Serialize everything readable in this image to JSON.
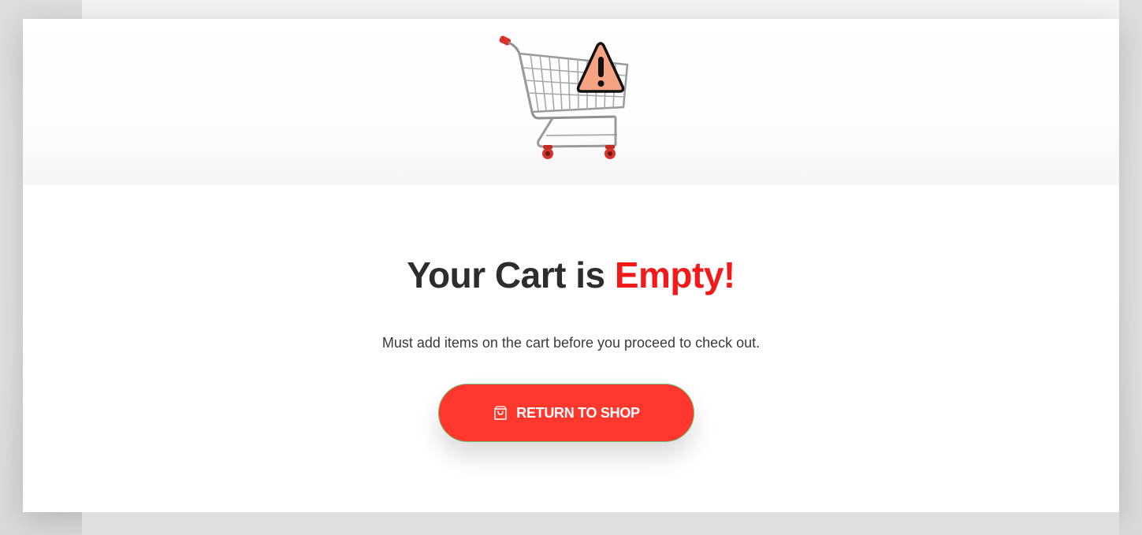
{
  "page": {
    "title_main": "Your Cart is",
    "title_accent": "Empty!",
    "subtitle": "Must add items on the cart before you proceed to check out."
  },
  "actions": {
    "return_label": "RETURN TO SHOP"
  },
  "icons": {
    "hero": "shopping-cart-warning-icon",
    "button": "shopping-bag-icon"
  },
  "colors": {
    "accent": "#f21a1a",
    "button_bg": "#ff372d",
    "button_border": "#6cc26c",
    "title_text": "#2d2d2d",
    "body_text": "#3a3a3a"
  }
}
